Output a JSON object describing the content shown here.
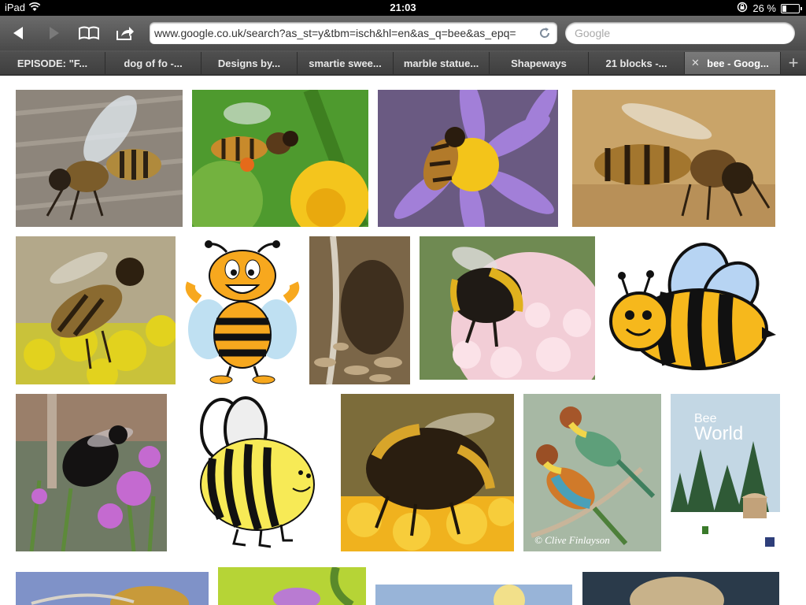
{
  "status": {
    "device": "iPad",
    "time": "21:03",
    "battery": "26 %",
    "battery_fraction": 0.26
  },
  "toolbar": {
    "url": "www.google.co.uk/search?as_st=y&tbm=isch&hl=en&as_q=bee&as_epq=",
    "search_placeholder": "Google"
  },
  "tabs": [
    {
      "label": "EPISODE: \"F..."
    },
    {
      "label": "dog of fo -..."
    },
    {
      "label": "Designs by..."
    },
    {
      "label": "smartie swee..."
    },
    {
      "label": "marble statue..."
    },
    {
      "label": "Shapeways"
    },
    {
      "label": "21 blocks -..."
    },
    {
      "label": "bee - Goog..."
    }
  ],
  "images": {
    "bee_world_cover": {
      "title": "Bee",
      "title2": "World"
    },
    "bird_photo": {
      "credit": "© Clive Finlayson"
    }
  },
  "colors": {
    "toolbar": "#555555",
    "accent": "#3a6fc8"
  }
}
